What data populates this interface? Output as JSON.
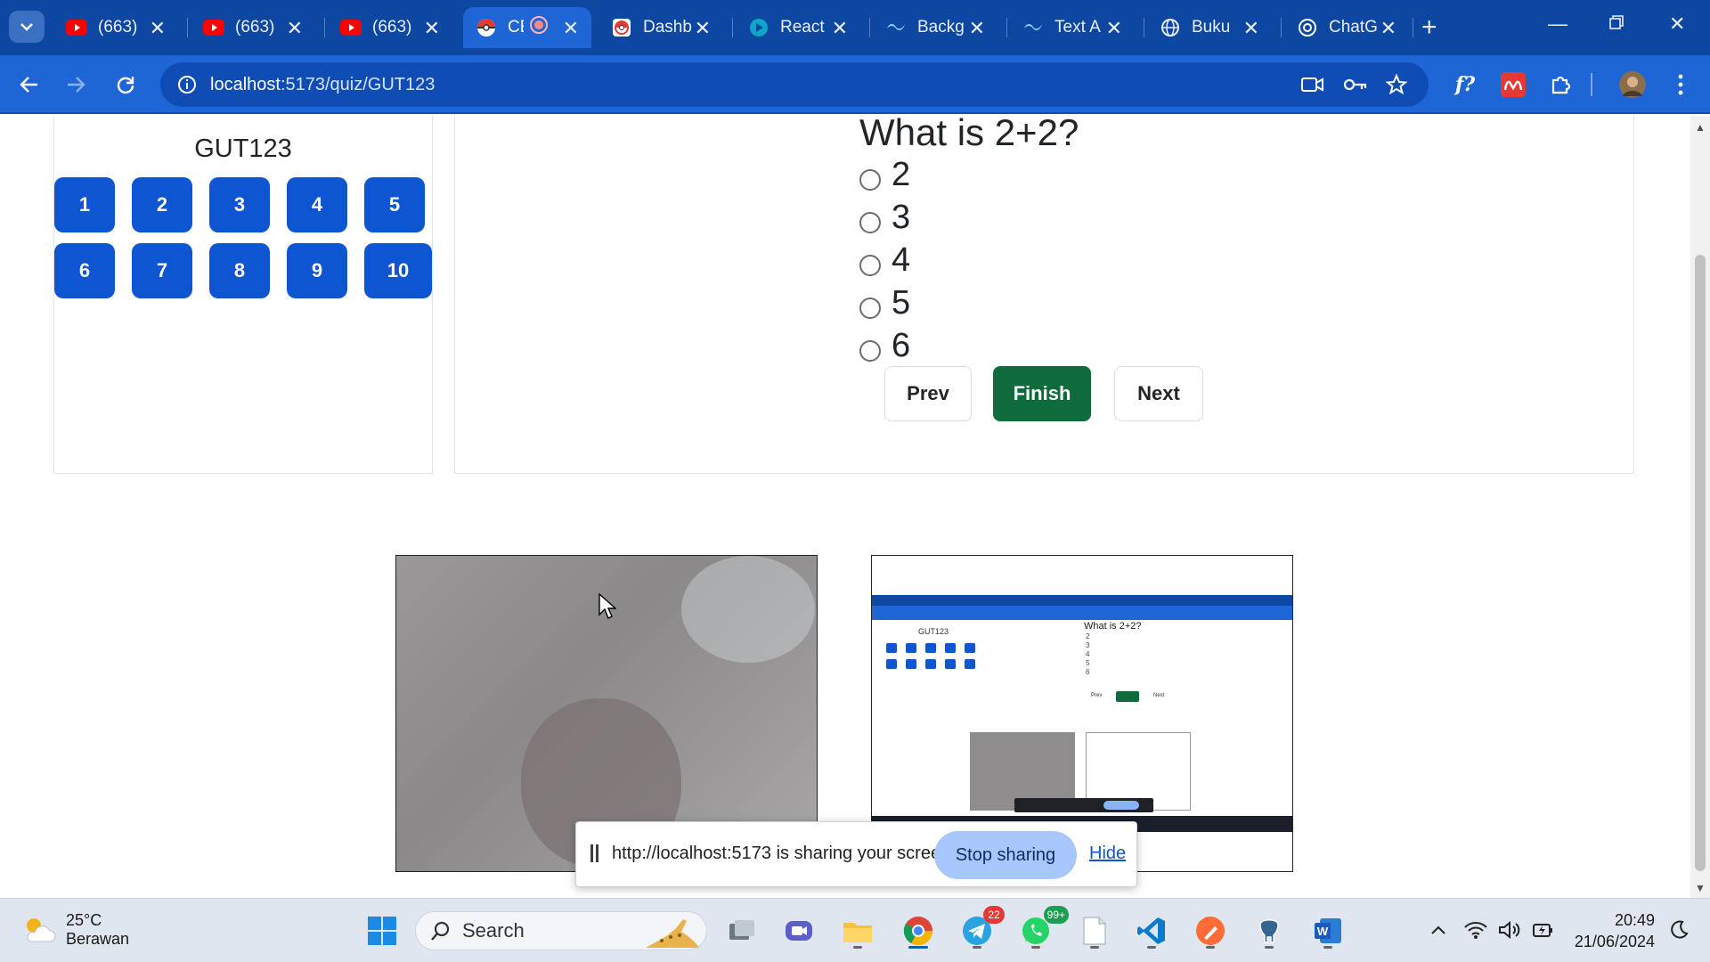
{
  "browser": {
    "tabs": [
      {
        "title": "(663) ",
        "favicon": "youtube-icon"
      },
      {
        "title": "(663)",
        "favicon": "youtube-icon"
      },
      {
        "title": "(663)",
        "favicon": "youtube-icon"
      },
      {
        "title": "CE",
        "favicon": "pokeball-icon",
        "active": true,
        "recording": true
      },
      {
        "title": "Dashb",
        "favicon": "pokeball-icon"
      },
      {
        "title": "React",
        "favicon": "react-icon"
      },
      {
        "title": "Backg",
        "favicon": "tailwind-icon"
      },
      {
        "title": "Text A",
        "favicon": "tailwind-icon"
      },
      {
        "title": "Buku",
        "favicon": "globe-icon"
      },
      {
        "title": "ChatG",
        "favicon": "openai-icon"
      }
    ],
    "url_host": "localhost",
    "url_path": ":5173/quiz/GUT123",
    "colors": {
      "tabbar": "#0d47a1",
      "toolbar": "#1e66d6"
    }
  },
  "quiz": {
    "code": "GUT123",
    "question_numbers": [
      "1",
      "2",
      "3",
      "4",
      "5",
      "6",
      "7",
      "8",
      "9",
      "10"
    ],
    "question": "What is 2+2?",
    "options": [
      "2",
      "3",
      "4",
      "5",
      "6"
    ],
    "buttons": {
      "prev": "Prev",
      "finish": "Finish",
      "next": "Next"
    },
    "colors": {
      "question_button": "#0d55d1",
      "finish": "#0e6b3c"
    }
  },
  "screen_preview": {
    "code": "GUT123",
    "question": "What is 2+2?",
    "options": [
      "2",
      "3",
      "4",
      "5",
      "6"
    ]
  },
  "share_bar": {
    "message": "http://localhost:5173 is sharing your screen.",
    "stop": "Stop sharing",
    "hide": "Hide"
  },
  "taskbar": {
    "weather_temp": "25°C",
    "weather_cond": "Berawan",
    "search_label": "Search",
    "telegram_badge": "22",
    "whatsapp_badge": "99+",
    "time": "20:49",
    "date": "21/06/2024"
  }
}
